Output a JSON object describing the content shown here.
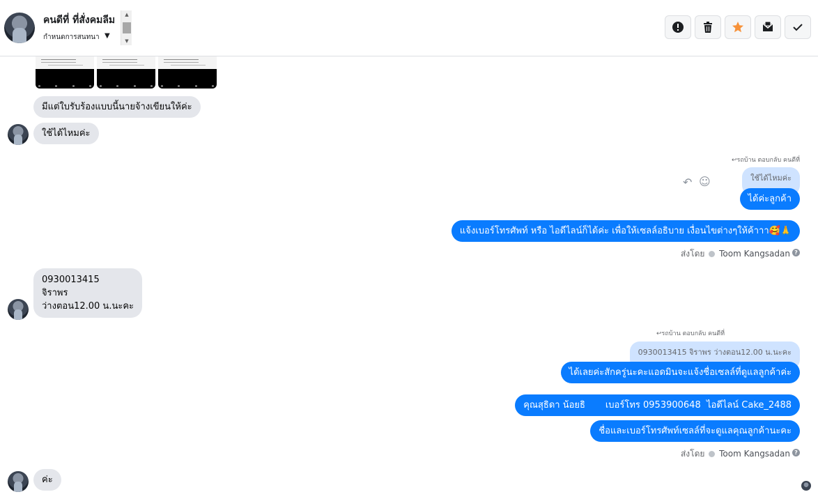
{
  "header": {
    "name": "คนดีที่ ที่สั่งคมลีม",
    "status": "กำหนดการสนทนา",
    "buttons": {
      "spam": "exclamation-icon",
      "delete": "trash-icon",
      "star": "star-icon",
      "mark_unread": "envelope-icon",
      "done": "check-icon"
    },
    "colors": {
      "star": "#f7923a"
    }
  },
  "messages": {
    "in1": "มีแต่ใบรับร้องแบบนี้นายจ้างเขียนให้ค่ะ",
    "in2": "ใช้ได้ไหมค่ะ",
    "reply1_label": "รถบ้าน ตอบกลับ คนดีที่",
    "reply1_quote": "ใช้ได้ไหมค่ะ",
    "out1": "ได้ค่ะลูกค้า",
    "out2": "แจ้งเบอร์โทรศัพท์ หรือ ไอดีไลน์ก็ได้ค่ะ เพื่อให้เซลล์อธิบาย เงื่อนไขต่างๆให้ค้าาา🥰🙏",
    "sent_by_1": "ส่งโดย",
    "sender_1": "Toom Kangsadan",
    "in3_line1": "0930013415",
    "in3_line2": "จิราพร",
    "in3_line3": "ว่างตอน12.00 น.นะคะ",
    "reply2_label": "รถบ้าน ตอบกลับ คนดีที่",
    "reply2_quote": "0930013415 จิราพร ว่างตอน12.00 น.นะคะ",
    "out3": "ได้เลยค่ะสักครู่นะคะแอดมินจะแจ้งชื่อเซลล์ที่ดูแลลูกค้าค่ะ",
    "out4": "คุณสุธิดา น้อยธิ       เบอร์โทร 0953900648  ไอดีไลน์ Cake_2488",
    "out5": "ชื่อและเบอร์โทรศัพท์เซลล์ที่จะดูแลคุณลูกค้านะคะ",
    "sent_by_2": "ส่งโดย",
    "sender_2": "Toom Kangsadan",
    "in4": "ค่ะ"
  },
  "colors": {
    "outgoing": "#0a7cff",
    "incoming": "#e4e6eb",
    "quoted": "#cfe3ff"
  }
}
